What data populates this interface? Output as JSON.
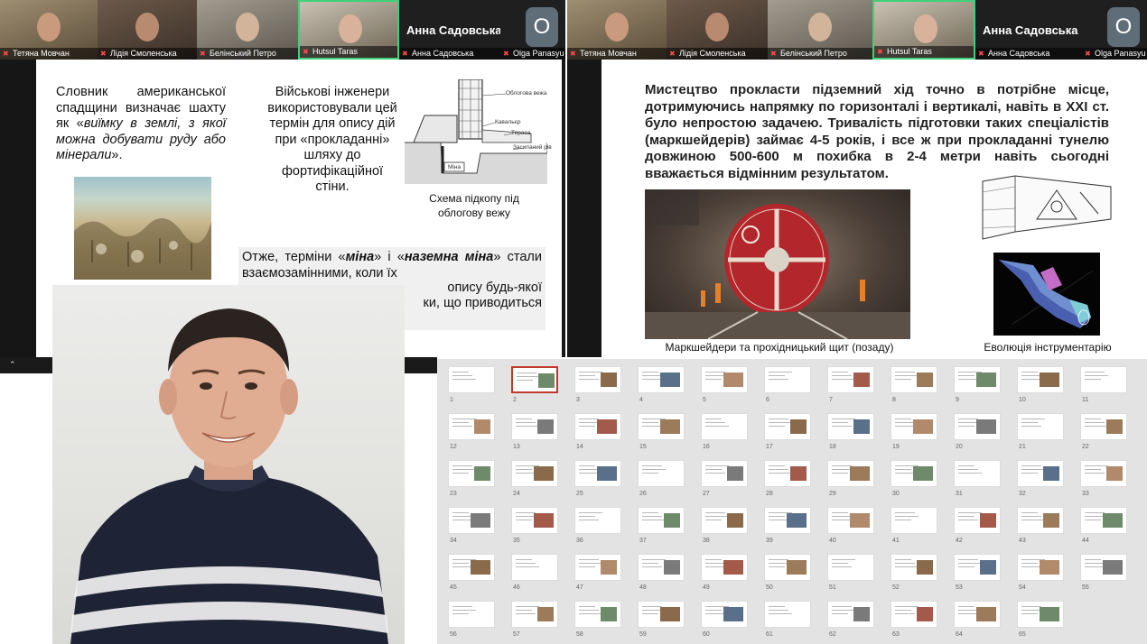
{
  "left_meeting": {
    "participants": [
      {
        "name": "Тетяна Мовчан",
        "muted": true
      },
      {
        "name": "Лідія Смоленська",
        "muted": true
      },
      {
        "name": "Белінський Петро",
        "muted": true
      },
      {
        "name": "Hutsul Taras",
        "muted": true,
        "active": true
      },
      {
        "name": "Анна Садовська",
        "muted": true
      },
      {
        "name": "Olga Panasyu",
        "muted": true
      }
    ],
    "featured_name": "Анна Садовська",
    "featured_initial": "О",
    "slide": {
      "p1_a": "Словник американської спадщини визначає шахту як «",
      "p1_b": "виїмку в землі, з якої можна добувати руду або мінерали",
      "p1_c": "».",
      "p2": "Військові інженери використовували цей термін для опису дій при «прокладанні» шляху до фортифікаційної стіни.",
      "diagram_labels": [
        "Облогова вежа",
        "Кавальєр",
        "Тераса",
        "Засипаний рів",
        "Міна"
      ],
      "diagram_caption": "Схема підкопу під облогову вежу",
      "p3_a": "Отже, терміни «",
      "p3_b": "міна",
      "p3_c": "» і «",
      "p3_d": "наземна міна",
      "p3_e": "» стали взаємозамінними, коли їх",
      "p3_line2": "опису будь-якої",
      "p3_line3": "ки, що приводиться"
    }
  },
  "right_meeting": {
    "participants": [
      {
        "name": "Тетяна Мовчан",
        "muted": true
      },
      {
        "name": "Лідія Смоленська",
        "muted": true
      },
      {
        "name": "Белінський Петро",
        "muted": true
      },
      {
        "name": "Hutsul Taras",
        "muted": true,
        "active": true
      },
      {
        "name": "Анна Садовська",
        "muted": true
      },
      {
        "name": "Olga Panasyu",
        "muted": true
      }
    ],
    "featured_name": "Анна Садовська",
    "featured_initial": "О",
    "slide": {
      "text": "Мистецтво прокласти підземний хід точно в потрібне місце, дотримуючись напрямку по горизонталі і вертикалі, навіть в XXI ст. було непростою задачею. Тривалість підготовки таких спеціалістів (маркшейдерів) займає 4-5 років, і все ж при прокладанні тунелю довжиною 500-600 м похибка в 2-4 метри навіть сьогодні вважається відмінним результатом.",
      "caption_left": "Маркшейдери та прохідницький щит (позаду)",
      "caption_right": "Еволюція інструментарію"
    }
  },
  "slide_sorter": {
    "selected": 2,
    "numbers": [
      "1",
      "2",
      "3",
      "4",
      "5",
      "6",
      "7",
      "8",
      "9",
      "10",
      "11",
      "12",
      "13",
      "14",
      "15",
      "16",
      "17",
      "18",
      "19",
      "20",
      "21",
      "22",
      "23",
      "24",
      "25",
      "26",
      "27",
      "28",
      "29",
      "30",
      "31",
      "32",
      "33",
      "34",
      "35",
      "36",
      "37",
      "38",
      "39",
      "40",
      "41",
      "42",
      "43",
      "44",
      "45",
      "46",
      "47",
      "48",
      "49",
      "50",
      "51",
      "52",
      "53",
      "54",
      "55",
      "56",
      "57",
      "58",
      "59",
      "60",
      "61",
      "62",
      "63",
      "64",
      "65"
    ]
  },
  "colors": {
    "accent": "#3fd07a",
    "selected": "#c0392b",
    "strip": "#1c1c1c"
  }
}
